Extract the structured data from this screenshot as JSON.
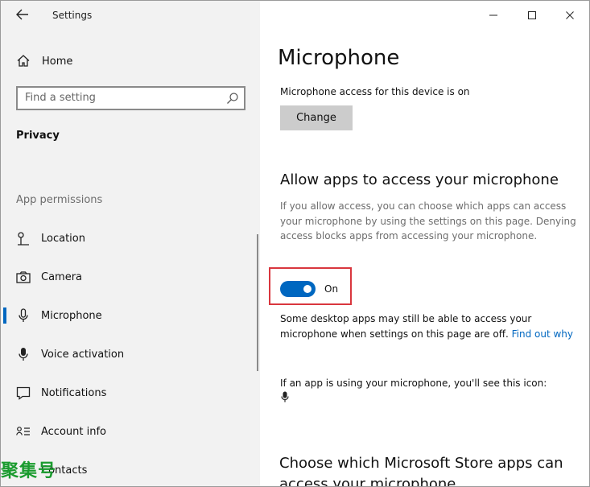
{
  "window": {
    "title": "Settings",
    "controls": {
      "minimize": "minimize",
      "maximize": "maximize",
      "close": "close"
    }
  },
  "sidebar": {
    "home_label": "Home",
    "search_placeholder": "Find a setting",
    "section_label": "Privacy",
    "group_heading": "App permissions",
    "items": [
      {
        "label": "Location",
        "icon": "location-icon",
        "selected": false
      },
      {
        "label": "Camera",
        "icon": "camera-icon",
        "selected": false
      },
      {
        "label": "Microphone",
        "icon": "microphone-icon",
        "selected": true
      },
      {
        "label": "Voice activation",
        "icon": "voice-activation-icon",
        "selected": false
      },
      {
        "label": "Notifications",
        "icon": "notifications-icon",
        "selected": false
      },
      {
        "label": "Account info",
        "icon": "account-info-icon",
        "selected": false
      },
      {
        "label": "Contacts",
        "icon": "contacts-icon",
        "selected": false
      }
    ]
  },
  "watermark": "聚集号",
  "main": {
    "title": "Microphone",
    "device_access_status": "Microphone access for this device is on",
    "change_button": "Change",
    "allow_heading": "Allow apps to access your microphone",
    "allow_description": "If you allow access, you can choose which apps can access your microphone by using the settings on this page. Denying access blocks apps from accessing your microphone.",
    "toggle": {
      "state": "On",
      "enabled": true
    },
    "desktop_note": "Some desktop apps may still be able to access your microphone when settings on this page are off.",
    "find_out_link": "Find out why",
    "icon_note": "If an app is using your microphone, you'll see this icon:",
    "store_heading": "Choose which Microsoft Store apps can access your microphone"
  },
  "colors": {
    "accent": "#0067c0",
    "highlight_box": "#d9363e",
    "watermark": "#1a9b2e",
    "sidebar_bg": "#f2f2f2"
  }
}
